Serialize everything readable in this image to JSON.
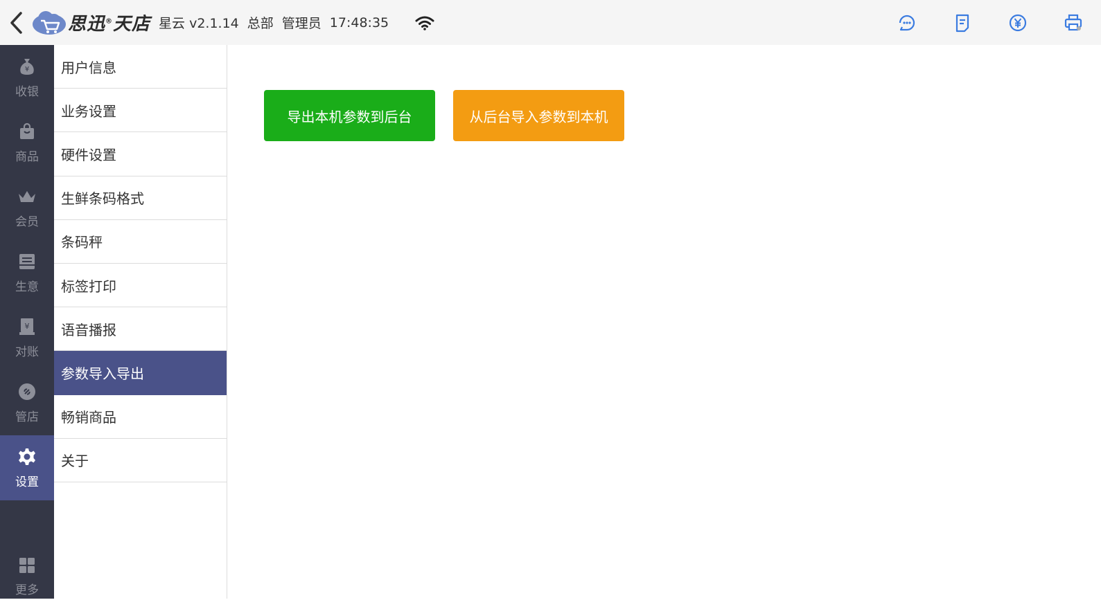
{
  "header": {
    "logo_text": "思迅",
    "logo_suffix": "天店",
    "logo_reg": "®",
    "app_version": "星云 v2.1.14",
    "store": "总部",
    "user": "管理员",
    "time": "17:48:35"
  },
  "leftnav": {
    "items": [
      {
        "label": "收银",
        "icon": "money-bag-icon"
      },
      {
        "label": "商品",
        "icon": "shopping-bag-icon"
      },
      {
        "label": "会员",
        "icon": "crown-icon"
      },
      {
        "label": "生意",
        "icon": "register-icon"
      },
      {
        "label": "对账",
        "icon": "ledger-icon"
      },
      {
        "label": "管店",
        "icon": "store-icon"
      },
      {
        "label": "设置",
        "icon": "gear-icon"
      }
    ],
    "more_label": "更多"
  },
  "submenu": {
    "items": [
      {
        "label": "用户信息"
      },
      {
        "label": "业务设置"
      },
      {
        "label": "硬件设置"
      },
      {
        "label": "生鲜条码格式"
      },
      {
        "label": "条码秤"
      },
      {
        "label": "标签打印"
      },
      {
        "label": "语音播报"
      },
      {
        "label": "参数导入导出"
      },
      {
        "label": "畅销商品"
      },
      {
        "label": "关于"
      }
    ]
  },
  "main": {
    "export_button": "导出本机参数到后台",
    "import_button": "从后台导入参数到本机"
  },
  "colors": {
    "accent": "#4a5289",
    "nav_bg": "#343746",
    "export_green": "#1aad19",
    "import_orange": "#f39c12",
    "icon_blue": "#3a7be0"
  }
}
